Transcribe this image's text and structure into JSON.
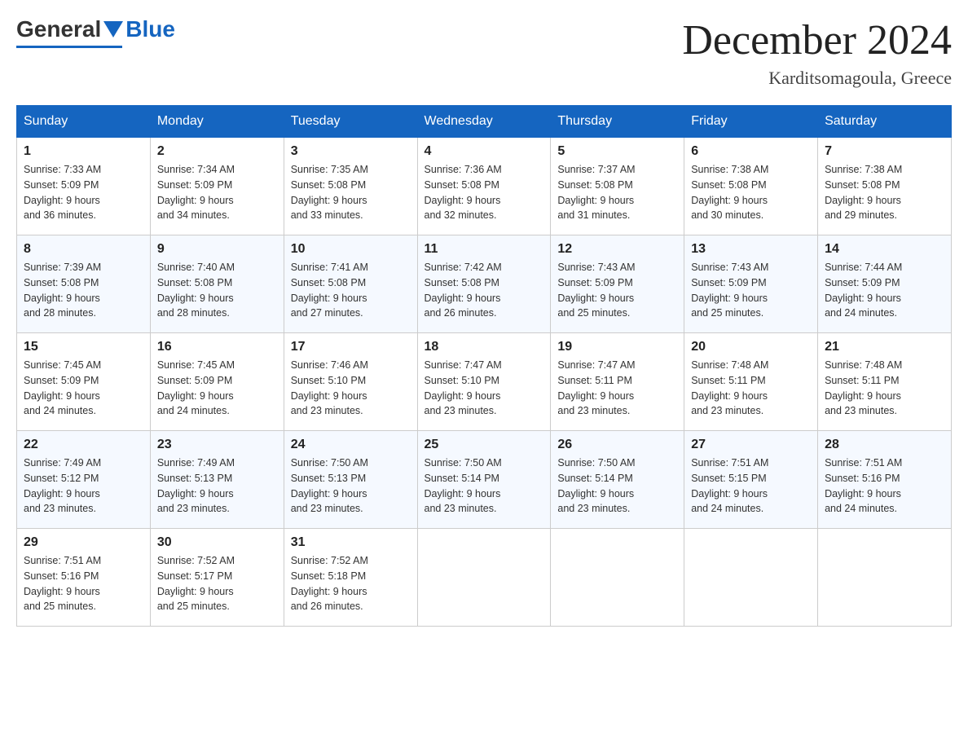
{
  "logo": {
    "general": "General",
    "blue": "Blue"
  },
  "header": {
    "month": "December 2024",
    "location": "Karditsomagoula, Greece"
  },
  "days": [
    "Sunday",
    "Monday",
    "Tuesday",
    "Wednesday",
    "Thursday",
    "Friday",
    "Saturday"
  ],
  "weeks": [
    [
      {
        "num": "1",
        "sunrise": "7:33 AM",
        "sunset": "5:09 PM",
        "daylight": "9 hours and 36 minutes."
      },
      {
        "num": "2",
        "sunrise": "7:34 AM",
        "sunset": "5:09 PM",
        "daylight": "9 hours and 34 minutes."
      },
      {
        "num": "3",
        "sunrise": "7:35 AM",
        "sunset": "5:08 PM",
        "daylight": "9 hours and 33 minutes."
      },
      {
        "num": "4",
        "sunrise": "7:36 AM",
        "sunset": "5:08 PM",
        "daylight": "9 hours and 32 minutes."
      },
      {
        "num": "5",
        "sunrise": "7:37 AM",
        "sunset": "5:08 PM",
        "daylight": "9 hours and 31 minutes."
      },
      {
        "num": "6",
        "sunrise": "7:38 AM",
        "sunset": "5:08 PM",
        "daylight": "9 hours and 30 minutes."
      },
      {
        "num": "7",
        "sunrise": "7:38 AM",
        "sunset": "5:08 PM",
        "daylight": "9 hours and 29 minutes."
      }
    ],
    [
      {
        "num": "8",
        "sunrise": "7:39 AM",
        "sunset": "5:08 PM",
        "daylight": "9 hours and 28 minutes."
      },
      {
        "num": "9",
        "sunrise": "7:40 AM",
        "sunset": "5:08 PM",
        "daylight": "9 hours and 28 minutes."
      },
      {
        "num": "10",
        "sunrise": "7:41 AM",
        "sunset": "5:08 PM",
        "daylight": "9 hours and 27 minutes."
      },
      {
        "num": "11",
        "sunrise": "7:42 AM",
        "sunset": "5:08 PM",
        "daylight": "9 hours and 26 minutes."
      },
      {
        "num": "12",
        "sunrise": "7:43 AM",
        "sunset": "5:09 PM",
        "daylight": "9 hours and 25 minutes."
      },
      {
        "num": "13",
        "sunrise": "7:43 AM",
        "sunset": "5:09 PM",
        "daylight": "9 hours and 25 minutes."
      },
      {
        "num": "14",
        "sunrise": "7:44 AM",
        "sunset": "5:09 PM",
        "daylight": "9 hours and 24 minutes."
      }
    ],
    [
      {
        "num": "15",
        "sunrise": "7:45 AM",
        "sunset": "5:09 PM",
        "daylight": "9 hours and 24 minutes."
      },
      {
        "num": "16",
        "sunrise": "7:45 AM",
        "sunset": "5:09 PM",
        "daylight": "9 hours and 24 minutes."
      },
      {
        "num": "17",
        "sunrise": "7:46 AM",
        "sunset": "5:10 PM",
        "daylight": "9 hours and 23 minutes."
      },
      {
        "num": "18",
        "sunrise": "7:47 AM",
        "sunset": "5:10 PM",
        "daylight": "9 hours and 23 minutes."
      },
      {
        "num": "19",
        "sunrise": "7:47 AM",
        "sunset": "5:11 PM",
        "daylight": "9 hours and 23 minutes."
      },
      {
        "num": "20",
        "sunrise": "7:48 AM",
        "sunset": "5:11 PM",
        "daylight": "9 hours and 23 minutes."
      },
      {
        "num": "21",
        "sunrise": "7:48 AM",
        "sunset": "5:11 PM",
        "daylight": "9 hours and 23 minutes."
      }
    ],
    [
      {
        "num": "22",
        "sunrise": "7:49 AM",
        "sunset": "5:12 PM",
        "daylight": "9 hours and 23 minutes."
      },
      {
        "num": "23",
        "sunrise": "7:49 AM",
        "sunset": "5:13 PM",
        "daylight": "9 hours and 23 minutes."
      },
      {
        "num": "24",
        "sunrise": "7:50 AM",
        "sunset": "5:13 PM",
        "daylight": "9 hours and 23 minutes."
      },
      {
        "num": "25",
        "sunrise": "7:50 AM",
        "sunset": "5:14 PM",
        "daylight": "9 hours and 23 minutes."
      },
      {
        "num": "26",
        "sunrise": "7:50 AM",
        "sunset": "5:14 PM",
        "daylight": "9 hours and 23 minutes."
      },
      {
        "num": "27",
        "sunrise": "7:51 AM",
        "sunset": "5:15 PM",
        "daylight": "9 hours and 24 minutes."
      },
      {
        "num": "28",
        "sunrise": "7:51 AM",
        "sunset": "5:16 PM",
        "daylight": "9 hours and 24 minutes."
      }
    ],
    [
      {
        "num": "29",
        "sunrise": "7:51 AM",
        "sunset": "5:16 PM",
        "daylight": "9 hours and 25 minutes."
      },
      {
        "num": "30",
        "sunrise": "7:52 AM",
        "sunset": "5:17 PM",
        "daylight": "9 hours and 25 minutes."
      },
      {
        "num": "31",
        "sunrise": "7:52 AM",
        "sunset": "5:18 PM",
        "daylight": "9 hours and 26 minutes."
      },
      null,
      null,
      null,
      null
    ]
  ],
  "labels": {
    "sunrise": "Sunrise:",
    "sunset": "Sunset:",
    "daylight": "Daylight:"
  }
}
